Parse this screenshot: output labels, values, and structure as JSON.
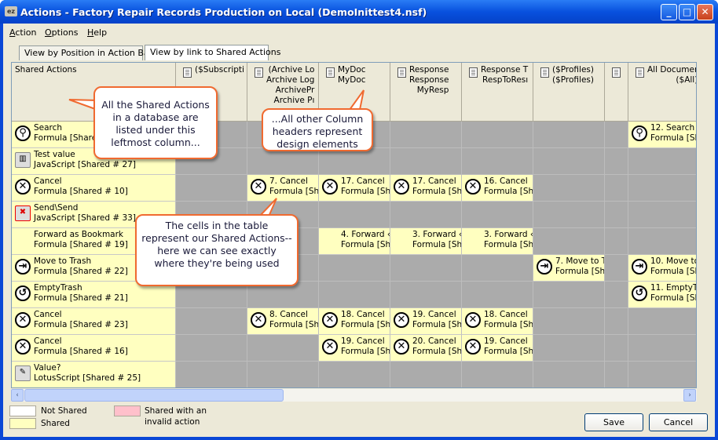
{
  "window": {
    "title": "Actions - Factory Repair Records Production on Local (DemoInittest4.nsf)",
    "app_icon": "ez-app-icon"
  },
  "menu": [
    "Action",
    "Options",
    "Help"
  ],
  "tabs": [
    {
      "label": "View by Position in Action Bars",
      "active": false
    },
    {
      "label": "View by link to Shared Actions",
      "active": true
    }
  ],
  "grid": {
    "first_header": "Shared Actions",
    "columns": [
      {
        "lines": [
          "($Subscripti"
        ]
      },
      {
        "lines": [
          "(Archive Lo",
          "Archive Log",
          "ArchivePr",
          "Archive Pı"
        ]
      },
      {
        "lines": [
          "MyDoc",
          "MyDoc"
        ]
      },
      {
        "lines": [
          "Response",
          "Response",
          "MyResp"
        ]
      },
      {
        "lines": [
          "Response T",
          "RespToResı"
        ]
      },
      {
        "lines": [
          "($Profiles)",
          "($Profiles)"
        ]
      },
      {
        "lines": []
      },
      {
        "lines": [
          "All Documer",
          "($All)"
        ]
      }
    ],
    "rows": [
      {
        "name": "Search",
        "sub": "Formula [Shared # 1]",
        "icon": "search-icon",
        "cells": [
          null,
          null,
          null,
          null,
          null,
          null,
          null,
          {
            "t": "12. Search",
            "s": "Formula [Sh",
            "icon": "search-icon"
          }
        ]
      },
      {
        "name": "Test value",
        "sub": "JavaScript [Shared # 27]",
        "icon": "chart-icon",
        "cells": []
      },
      {
        "name": "Cancel",
        "sub": "Formula [Shared # 10]",
        "icon": "cancel-icon",
        "cells": [
          null,
          {
            "t": "7. Cancel",
            "s": "Formula [Sh",
            "icon": "cancel-icon"
          },
          {
            "t": "17. Cancel",
            "s": "Formula [Sh",
            "icon": "cancel-icon"
          },
          {
            "t": "17. Cancel",
            "s": "Formula [Sh",
            "icon": "cancel-icon"
          },
          {
            "t": "16. Cancel",
            "s": "Formula [Sh",
            "icon": "cancel-icon"
          }
        ]
      },
      {
        "name": "Send\\Send",
        "sub": "JavaScript [Shared # 33]",
        "icon": "send-error-icon",
        "cells": []
      },
      {
        "name": "Forward as Bookmark",
        "sub": "Formula [Shared # 19]",
        "icon": "",
        "cells": [
          null,
          null,
          {
            "t": "4. Forward ‹",
            "s": "Formula [Sh",
            "icon": ""
          },
          {
            "t": "3. Forward ‹",
            "s": "Formula [Sh",
            "icon": ""
          },
          {
            "t": "3. Forward ‹",
            "s": "Formula [Sh",
            "icon": ""
          }
        ]
      },
      {
        "name": "Move to Trash",
        "sub": "Formula [Shared # 22]",
        "icon": "move-to-trash-icon",
        "cells": [
          null,
          null,
          null,
          null,
          null,
          {
            "t": "7. Move to T",
            "s": "Formula [Sh",
            "icon": "move-to-trash-icon"
          },
          null,
          {
            "t": "10. Move to",
            "s": "Formula [Sh",
            "icon": "move-to-trash-icon"
          }
        ]
      },
      {
        "name": "EmptyTrash",
        "sub": "Formula [Shared # 21]",
        "icon": "empty-trash-icon",
        "cells": [
          null,
          null,
          null,
          null,
          null,
          null,
          null,
          {
            "t": "11. EmptyT",
            "s": "Formula [Sh",
            "icon": "empty-trash-icon"
          }
        ]
      },
      {
        "name": "Cancel",
        "sub": "Formula [Shared # 23]",
        "icon": "cancel-icon",
        "cells": [
          null,
          {
            "t": "8. Cancel",
            "s": "Formula [Sh",
            "icon": "cancel-icon"
          },
          {
            "t": "18. Cancel",
            "s": "Formula [Sh",
            "icon": "cancel-icon"
          },
          {
            "t": "19. Cancel",
            "s": "Formula [Sh",
            "icon": "cancel-icon"
          },
          {
            "t": "18. Cancel",
            "s": "Formula [Sh",
            "icon": "cancel-icon"
          }
        ]
      },
      {
        "name": "Cancel",
        "sub": "Formula [Shared # 16]",
        "icon": "cancel-icon",
        "cells": [
          null,
          null,
          {
            "t": "19. Cancel",
            "s": "Formula [Sh",
            "icon": "cancel-icon"
          },
          {
            "t": "20. Cancel",
            "s": "Formula [Sh",
            "icon": "cancel-icon"
          },
          {
            "t": "19. Cancel",
            "s": "Formula [Sh",
            "icon": "cancel-icon"
          }
        ]
      },
      {
        "name": "Value?",
        "sub": "LotusScript [Shared # 25]",
        "icon": "script-icon",
        "cells": []
      }
    ]
  },
  "legend": {
    "not_shared": "Not Shared",
    "shared": "Shared",
    "invalid": "Shared with an invalid action",
    "colors": {
      "not_shared": "#ffffff",
      "shared": "#ffffc0",
      "invalid": "#ffc0cb"
    }
  },
  "buttons": {
    "save": "Save",
    "cancel": "Cancel"
  },
  "callouts": {
    "c1": "All the Shared Actions in a database are listed under this leftmost column...",
    "c2": "...All other Column headers represent design elements",
    "c3": "The cells in the table represent our Shared Actions--here we can see exactly where they're being used"
  }
}
